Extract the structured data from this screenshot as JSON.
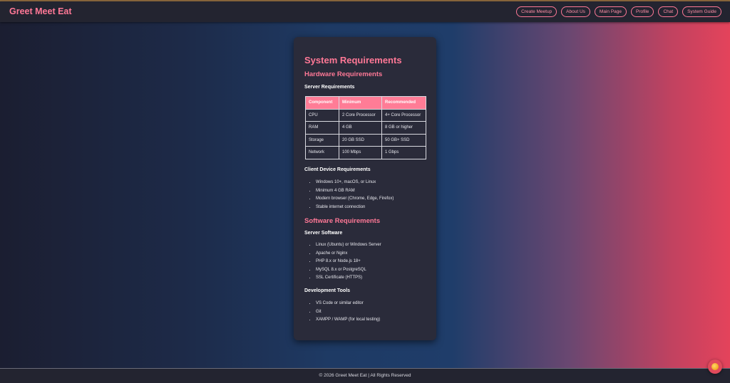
{
  "header": {
    "brand": "Greet Meet Eat",
    "nav": [
      "Create Meetup",
      "About Us",
      "Main Page",
      "Profile",
      "Chat",
      "System Guide"
    ]
  },
  "main": {
    "title": "System Requirements",
    "hardware": {
      "heading": "Hardware Requirements",
      "server": {
        "heading": "Server Requirements",
        "columns": [
          "Component",
          "Minimum",
          "Recommended"
        ],
        "rows": [
          [
            "CPU",
            "2 Core Processor",
            "4+ Core Processor"
          ],
          [
            "RAM",
            "4 GB",
            "8 GB or higher"
          ],
          [
            "Storage",
            "20 GB SSD",
            "50 GB+ SSD"
          ],
          [
            "Network",
            "100 Mbps",
            "1 Gbps"
          ]
        ]
      },
      "client": {
        "heading": "Client Device Requirements",
        "items": [
          "Windows 10+, macOS, or Linux",
          "Minimum 4 GB RAM",
          "Modern browser (Chrome, Edge, Firefox)",
          "Stable internet connection"
        ]
      }
    },
    "software": {
      "heading": "Software Requirements",
      "server": {
        "heading": "Server Software",
        "items": [
          "Linux (Ubuntu) or Windows Server",
          "Apache or Nginx",
          "PHP 8.x or Node.js 18+",
          "MySQL 8.x or PostgreSQL",
          "SSL Certificate (HTTPS)"
        ]
      },
      "tools": {
        "heading": "Development Tools",
        "items": [
          "VS Code or similar editor",
          "Git",
          "XAMPP / WAMP (for local testing)"
        ]
      }
    }
  },
  "footer": {
    "text": "© 2026 Greet Meet Eat | All Rights Reserved"
  },
  "colors": {
    "accent": "#ff7896",
    "card": "#2a2b3a",
    "header": "#232430"
  },
  "chat_fab": {
    "icon": "chat-bubble-icon"
  }
}
